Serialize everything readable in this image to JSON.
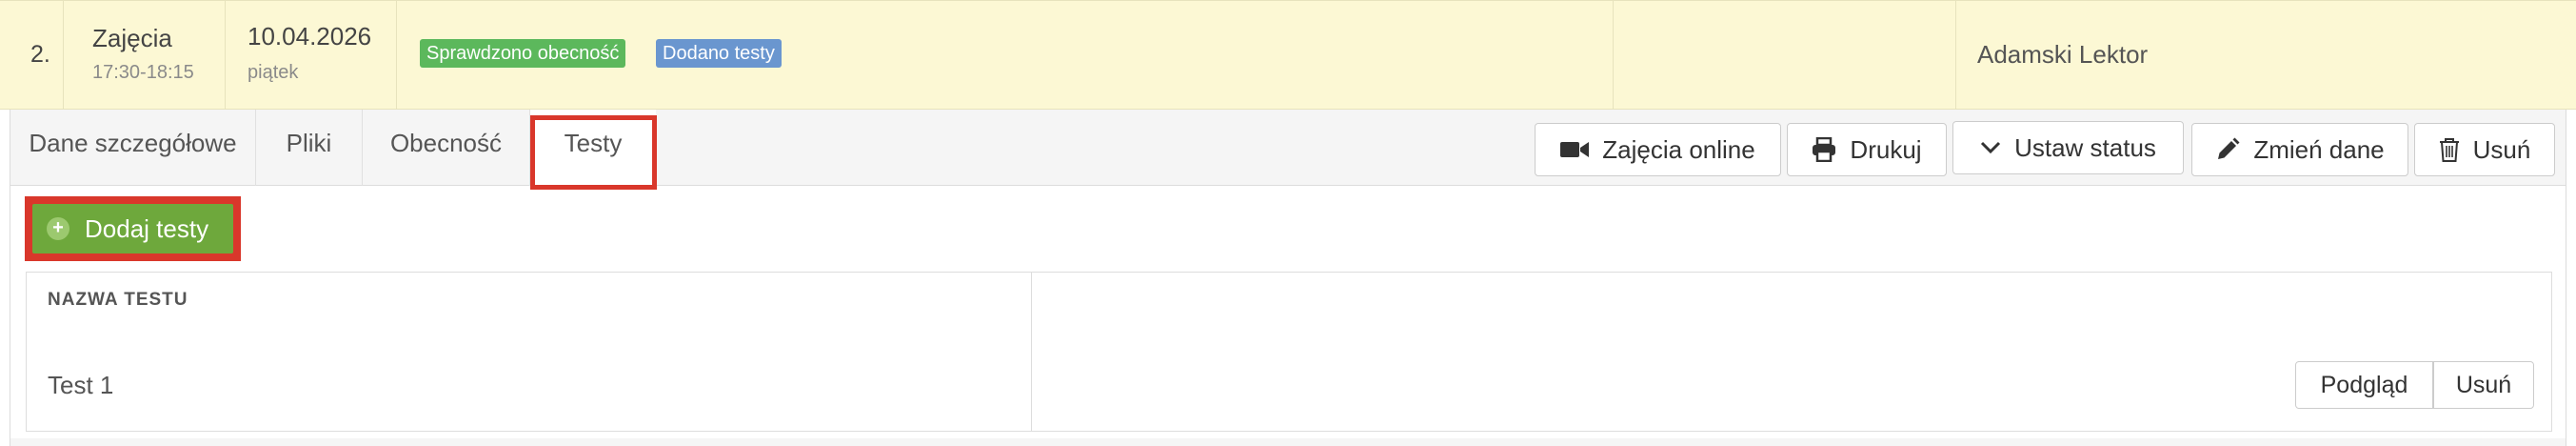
{
  "lesson": {
    "number": "2.",
    "type": "Zajęcia",
    "time": "17:30-18:15",
    "date": "10.04.2026",
    "weekday": "piątek",
    "badges": [
      {
        "label": "Sprawdzono obecność",
        "color": "#5cb85c"
      },
      {
        "label": "Dodano testy",
        "color": "#6a96cf"
      }
    ],
    "teacher": "Adamski Lektor",
    "row_color": "#fcf8d4"
  },
  "tabs": [
    {
      "label": "Dane szczegółowe",
      "active": false
    },
    {
      "label": "Pliki",
      "active": false
    },
    {
      "label": "Obecność",
      "active": false
    },
    {
      "label": "Testy",
      "active": true
    }
  ],
  "actions": {
    "online": {
      "label": "Zajęcia online",
      "icon": "video-camera-icon"
    },
    "print": {
      "label": "Drukuj",
      "icon": "printer-icon"
    },
    "status": {
      "label": "Ustaw status",
      "icon": "chevron-down-icon"
    },
    "edit": {
      "label": "Zmień dane",
      "icon": "pencil-icon"
    },
    "delete": {
      "label": "Usuń",
      "icon": "trash-icon"
    }
  },
  "add_tests": {
    "label": "Dodaj testy",
    "icon": "plus-circle-icon",
    "color": "#6ea83c"
  },
  "tests_table": {
    "column_header": "NAZWA TESTU",
    "rows": [
      {
        "name": "Test 1",
        "preview_label": "Podgląd",
        "remove_label": "Usuń"
      }
    ]
  },
  "highlight_color": "#d9372b"
}
